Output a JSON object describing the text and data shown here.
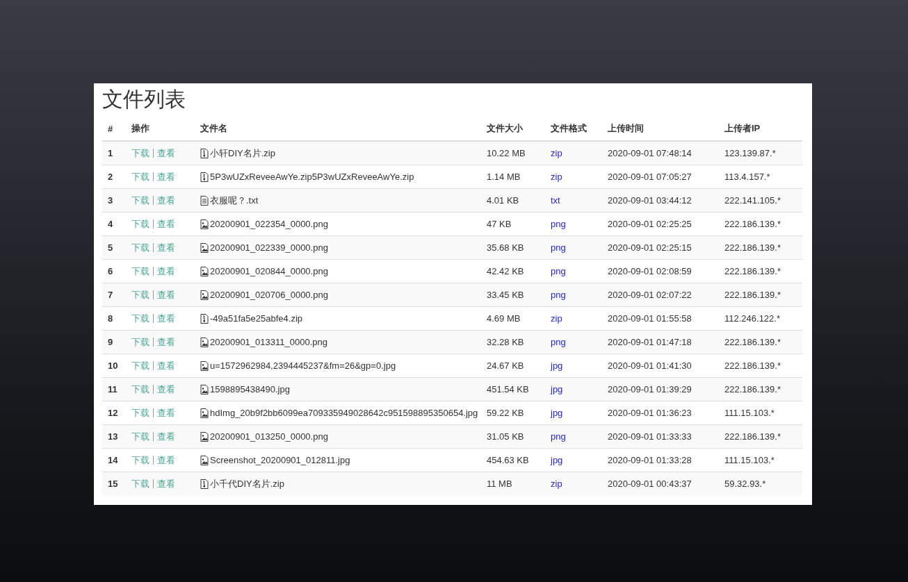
{
  "title": "文件列表",
  "table": {
    "columns": [
      "#",
      "操作",
      "文件名",
      "文件大小",
      "文件格式",
      "上传时间",
      "上传者IP"
    ],
    "rows": [
      {
        "index": "1",
        "download": "下载",
        "view": "查看",
        "kind": "archive",
        "name": "小轩DIY名片.zip",
        "size": "10.22 MB",
        "format": "zip",
        "time": "2020-09-01 07:48:14",
        "ip": "123.139.87.*"
      },
      {
        "index": "2",
        "download": "下载",
        "view": "查看",
        "kind": "archive",
        "name": "5P3wUZxReveeAwYe.zip5P3wUZxReveeAwYe.zip",
        "size": "1.14 MB",
        "format": "zip",
        "time": "2020-09-01 07:05:27",
        "ip": "113.4.157.*"
      },
      {
        "index": "3",
        "download": "下载",
        "view": "查看",
        "kind": "text",
        "name": "衣服呢？.txt",
        "size": "4.01 KB",
        "format": "txt",
        "time": "2020-09-01 03:44:12",
        "ip": "222.141.105.*"
      },
      {
        "index": "4",
        "download": "下载",
        "view": "查看",
        "kind": "image",
        "name": "20200901_022354_0000.png",
        "size": "47 KB",
        "format": "png",
        "time": "2020-09-01 02:25:25",
        "ip": "222.186.139.*"
      },
      {
        "index": "5",
        "download": "下载",
        "view": "查看",
        "kind": "image",
        "name": "20200901_022339_0000.png",
        "size": "35.68 KB",
        "format": "png",
        "time": "2020-09-01 02:25:15",
        "ip": "222.186.139.*"
      },
      {
        "index": "6",
        "download": "下载",
        "view": "查看",
        "kind": "image",
        "name": "20200901_020844_0000.png",
        "size": "42.42 KB",
        "format": "png",
        "time": "2020-09-01 02:08:59",
        "ip": "222.186.139.*"
      },
      {
        "index": "7",
        "download": "下载",
        "view": "查看",
        "kind": "image",
        "name": "20200901_020706_0000.png",
        "size": "33.45 KB",
        "format": "png",
        "time": "2020-09-01 02:07:22",
        "ip": "222.186.139.*"
      },
      {
        "index": "8",
        "download": "下载",
        "view": "查看",
        "kind": "archive",
        "name": "-49a51fa5e25abfe4.zip",
        "size": "4.69 MB",
        "format": "zip",
        "time": "2020-09-01 01:55:58",
        "ip": "112.246.122.*"
      },
      {
        "index": "9",
        "download": "下载",
        "view": "查看",
        "kind": "image",
        "name": "20200901_013311_0000.png",
        "size": "32.28 KB",
        "format": "png",
        "time": "2020-09-01 01:47:18",
        "ip": "222.186.139.*"
      },
      {
        "index": "10",
        "download": "下载",
        "view": "查看",
        "kind": "image",
        "name": "u=1572962984,2394445237&fm=26&gp=0.jpg",
        "size": "24.67 KB",
        "format": "jpg",
        "time": "2020-09-01 01:41:30",
        "ip": "222.186.139.*"
      },
      {
        "index": "11",
        "download": "下载",
        "view": "查看",
        "kind": "image",
        "name": "1598895438490.jpg",
        "size": "451.54 KB",
        "format": "jpg",
        "time": "2020-09-01 01:39:29",
        "ip": "222.186.139.*"
      },
      {
        "index": "12",
        "download": "下载",
        "view": "查看",
        "kind": "image",
        "name": "hdImg_20b9f2bb6099ea709335949028642c951598895350654.jpg",
        "size": "59.22 KB",
        "format": "jpg",
        "time": "2020-09-01 01:36:23",
        "ip": "111.15.103.*"
      },
      {
        "index": "13",
        "download": "下载",
        "view": "查看",
        "kind": "image",
        "name": "20200901_013250_0000.png",
        "size": "31.05 KB",
        "format": "png",
        "time": "2020-09-01 01:33:33",
        "ip": "222.186.139.*"
      },
      {
        "index": "14",
        "download": "下载",
        "view": "查看",
        "kind": "image",
        "name": "Screenshot_20200901_012811.jpg",
        "size": "454.63 KB",
        "format": "jpg",
        "time": "2020-09-01 01:33:28",
        "ip": "111.15.103.*"
      },
      {
        "index": "15",
        "download": "下载",
        "view": "查看",
        "kind": "archive",
        "name": "小千代DIY名片.zip",
        "size": "11 MB",
        "format": "zip",
        "time": "2020-09-01 00:43:37",
        "ip": "59.32.93.*"
      }
    ]
  }
}
